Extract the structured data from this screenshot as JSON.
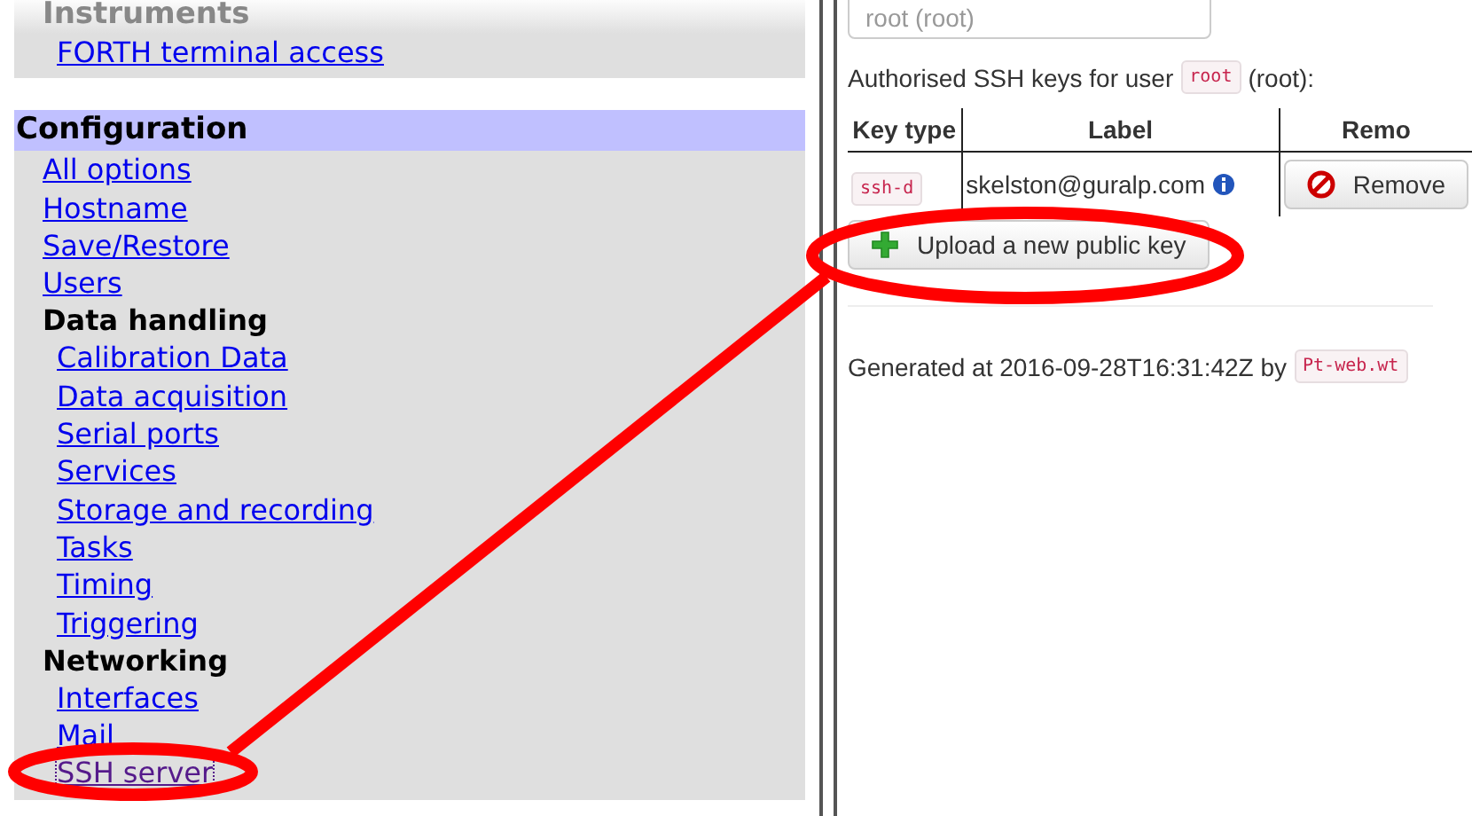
{
  "sidebar": {
    "sections": [
      {
        "title": "Instruments",
        "kind": "faded",
        "items": [
          {
            "label": "FORTH terminal access",
            "focused": false
          }
        ]
      },
      {
        "title": "Configuration",
        "kind": "highlight",
        "items": [
          {
            "label": "All options",
            "focused": false
          },
          {
            "label": "Hostname",
            "focused": false
          },
          {
            "label": "Save/Restore",
            "focused": false
          },
          {
            "label": "Users",
            "focused": false
          },
          {
            "label": "Data handling",
            "children": [
              {
                "label": "Calibration Data",
                "focused": false
              },
              {
                "label": "Data acquisition",
                "focused": false
              },
              {
                "label": "Serial ports",
                "focused": false
              },
              {
                "label": "Services",
                "focused": false
              },
              {
                "label": "Storage and recording",
                "focused": false
              },
              {
                "label": "Tasks",
                "focused": false
              },
              {
                "label": "Timing",
                "focused": false
              },
              {
                "label": "Triggering",
                "focused": false
              }
            ]
          },
          {
            "label": "Networking",
            "children": [
              {
                "label": "Interfaces",
                "focused": false
              },
              {
                "label": "Mail",
                "focused": false
              },
              {
                "label": "SSH server",
                "focused": true
              }
            ]
          }
        ]
      }
    ]
  },
  "content": {
    "user_select": {
      "value": "root (root)"
    },
    "keys_caption": {
      "before": "Authorised SSH keys for user",
      "code": "root",
      "after": "(root):"
    },
    "table": {
      "columns": [
        "Key type",
        "Label",
        "Remo"
      ],
      "rows": [
        {
          "key_type": "ssh-d",
          "label": "skelston@guralp.com",
          "action": "Remove"
        }
      ]
    },
    "upload_button": "Upload a new public key",
    "footer": {
      "text": "Generated at 2016-09-28T16:31:42Z by",
      "code": "Pt-web.wt"
    }
  }
}
